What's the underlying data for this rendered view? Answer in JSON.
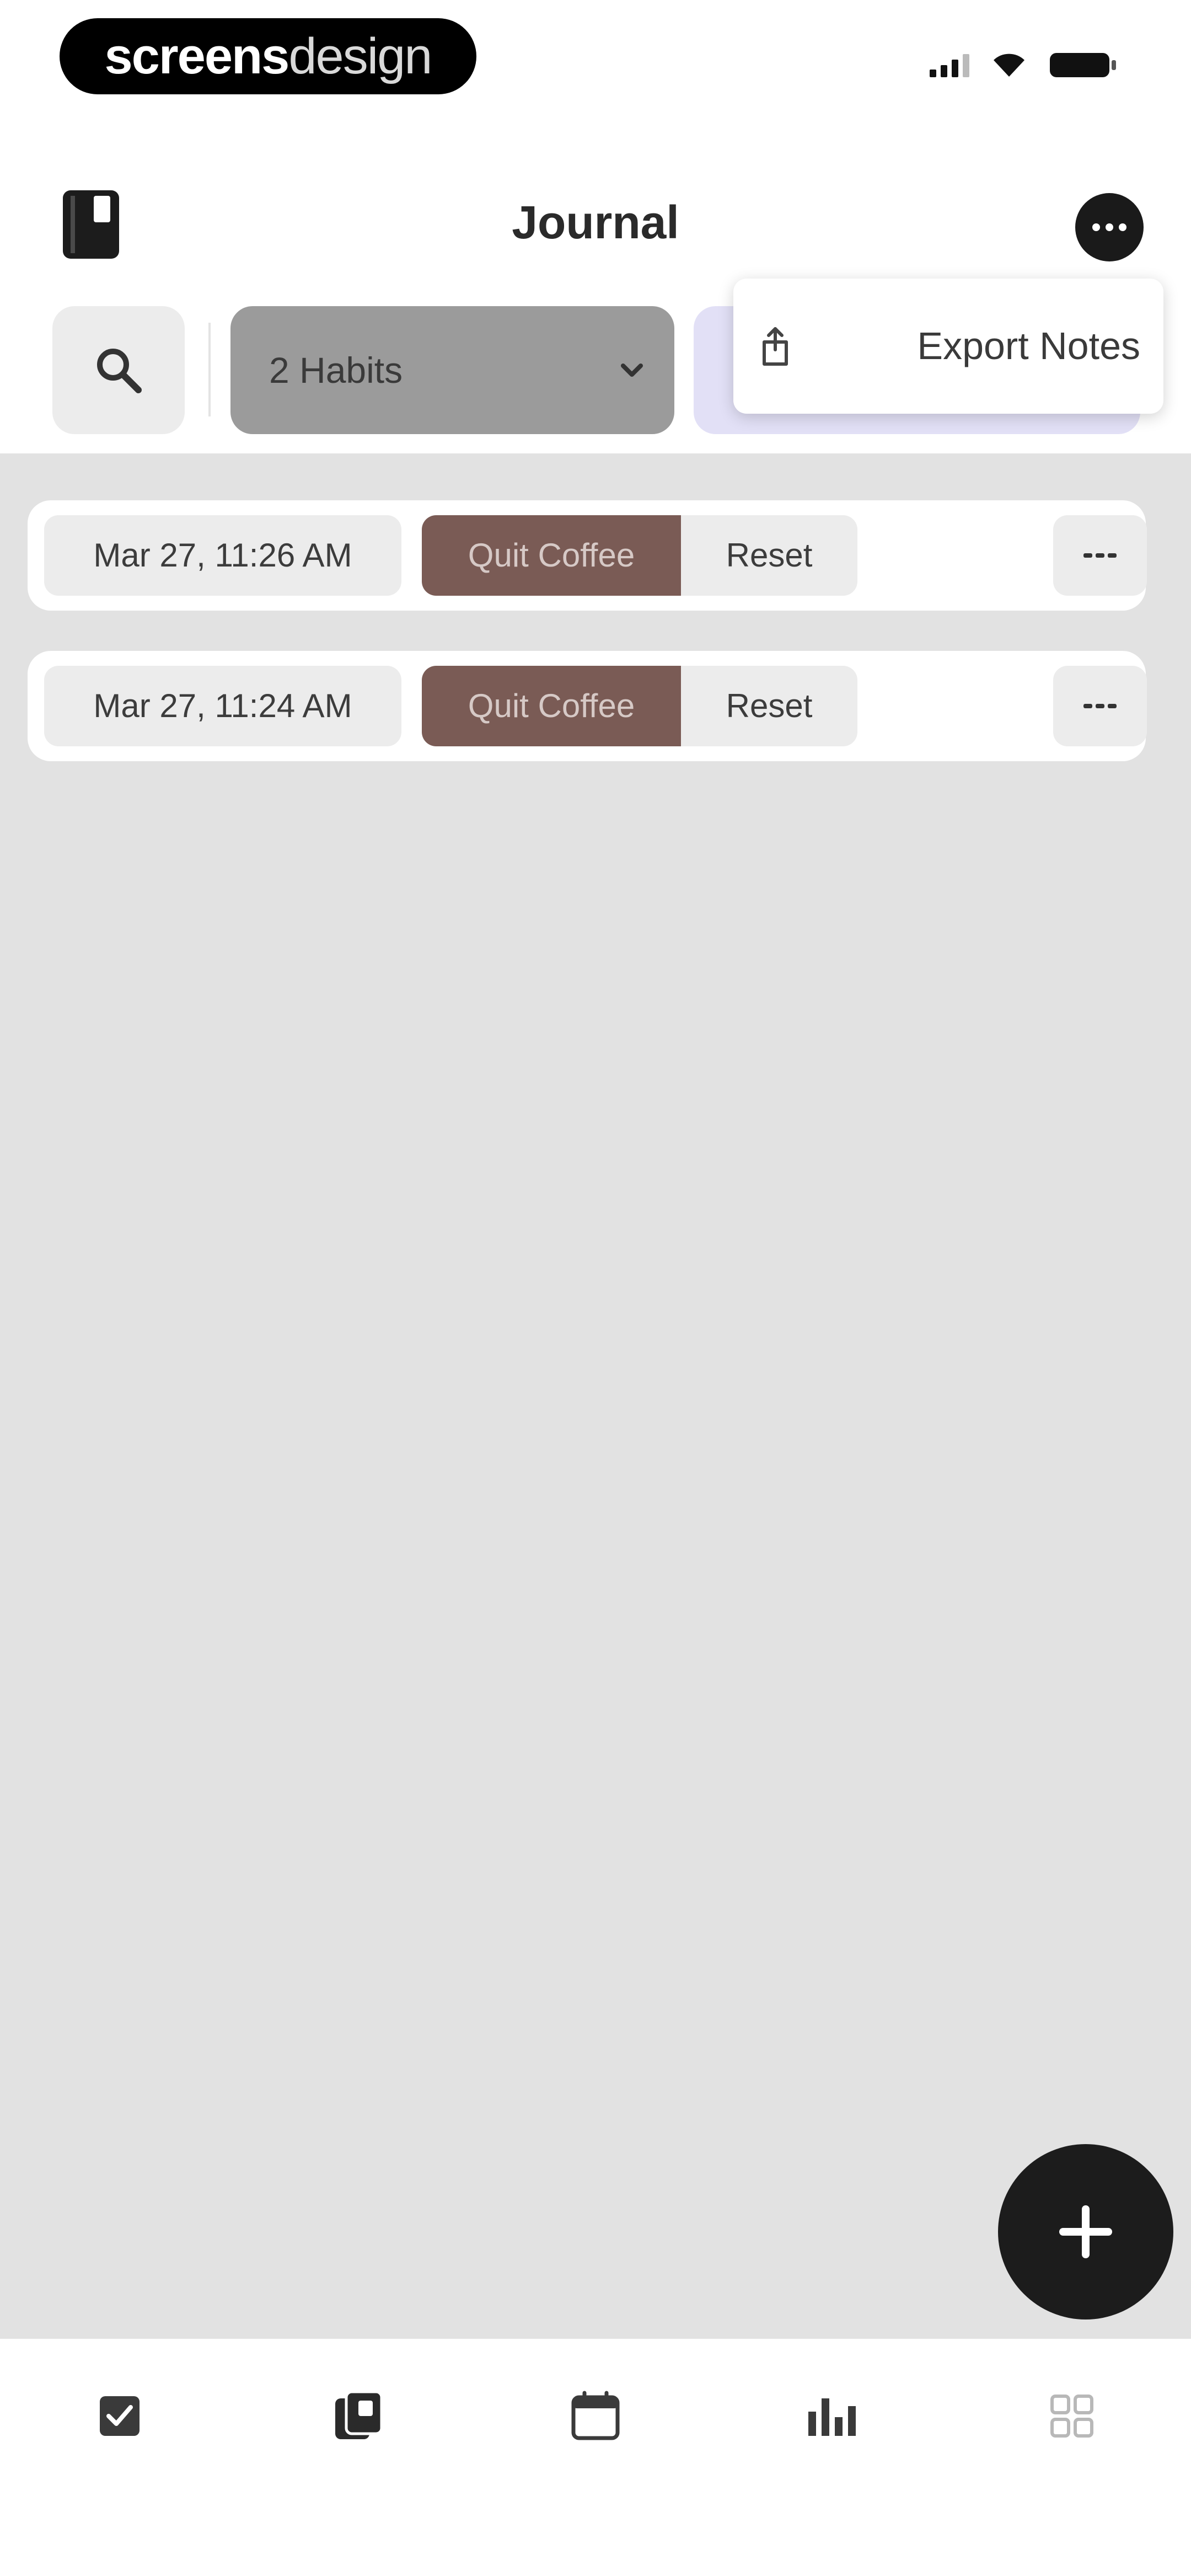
{
  "status_bar": {
    "logo_part1": "screens",
    "logo_part2": "design"
  },
  "header": {
    "title": "Journal"
  },
  "filters": {
    "habits_label": "2 Habits"
  },
  "menu": {
    "export_label": "Export Notes"
  },
  "entries": [
    {
      "date": "Mar 27, 11:26 AM",
      "habit": "Quit Coffee",
      "action": "Reset"
    },
    {
      "date": "Mar 27, 11:24 AM",
      "habit": "Quit Coffee",
      "action": "Reset"
    }
  ],
  "colors": {
    "habit_chip": "#7a5b55",
    "accent_dark": "#1c1c1c",
    "lavender_chip": "#e2e0f6",
    "content_bg": "#e2e2e2"
  },
  "tabs": [
    {
      "icon": "checkbox-icon"
    },
    {
      "icon": "journal-icon"
    },
    {
      "icon": "calendar-icon"
    },
    {
      "icon": "stats-icon"
    },
    {
      "icon": "grid-icon"
    }
  ]
}
